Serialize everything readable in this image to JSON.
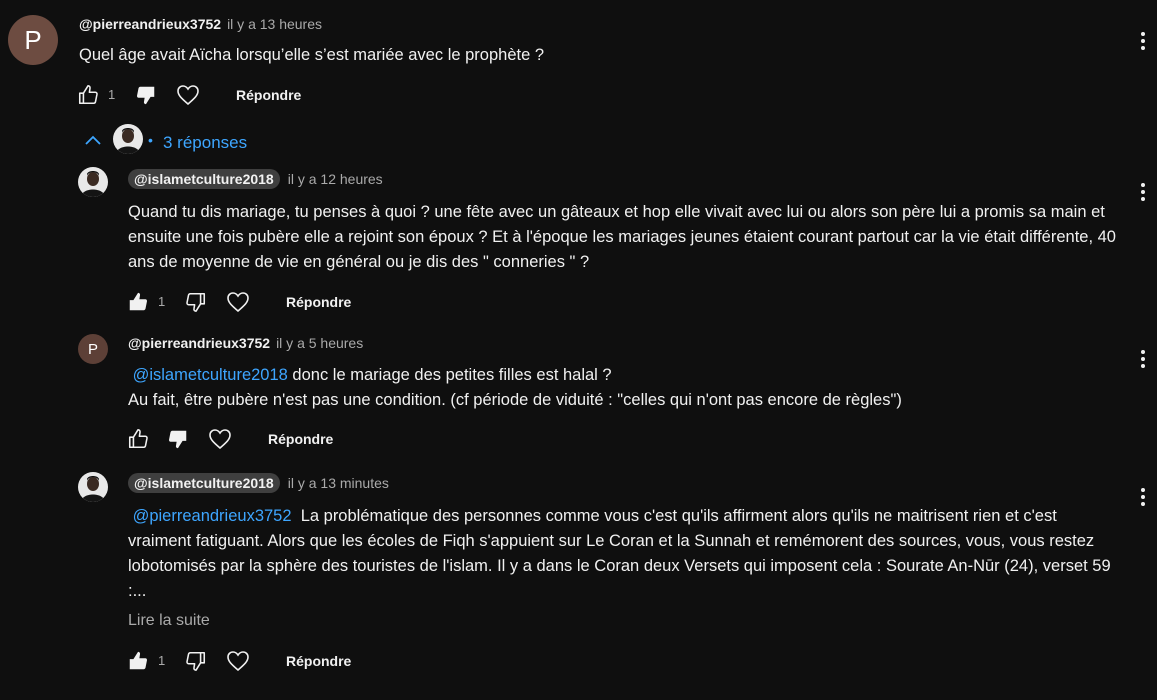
{
  "comment": {
    "avatar_letter": "P",
    "author": "@pierreandrieux3752",
    "time": "il y a 13 heures",
    "text": "Quel âge avait Aïcha lorsqu’elle s’est mariée avec le prophète ?",
    "likes": "1",
    "reply_label": "Répondre"
  },
  "replies_toggle": {
    "label": "3 réponses",
    "separator": "•"
  },
  "replies": [
    {
      "author": "@islametculture2018",
      "time": "il y a 12 heures",
      "text": "Quand tu dis mariage, tu penses à quoi ? une fête avec un gâteaux et hop elle vivait avec lui ou alors son père lui a promis sa main et ensuite une fois pubère elle a rejoint son époux ? Et à l'époque les mariages jeunes étaient courant partout car la vie était différente, 40 ans de moyenne de vie en général ou je dis des \" conneries \" ?",
      "likes": "1",
      "reply_label": "Répondre"
    },
    {
      "avatar_letter": "P",
      "author": "@pierreandrieux3752",
      "time": "il y a 5 heures",
      "mention": "@islametculture2018",
      "text_line1": " donc le mariage des petites filles est halal ?",
      "text_line2": "Au fait, être pubère n'est pas une condition. (cf période de viduité : \"celles qui n'ont pas encore de règles\")",
      "reply_label": "Répondre"
    },
    {
      "author": "@islametculture2018",
      "time": "il y a 13 minutes",
      "mention": "@pierreandrieux3752",
      "text": "  La problématique des personnes comme vous c'est qu'ils affirment alors qu'ils ne maitrisent rien et c'est vraiment fatiguant. Alors que les écoles de Fiqh s'appuient sur Le Coran et la Sunnah et remémorent des sources, vous, vous restez lobotomisés par la sphère des touristes de l'islam. Il y a dans le Coran deux Versets qui imposent cela : Sourate An-Nūr (24), verset 59 :...",
      "read_more": "Lire la suite",
      "likes": "1",
      "reply_label": "Répondre"
    }
  ],
  "icons": {
    "like": "thumbs-up-icon",
    "dislike": "thumbs-down-icon",
    "heart": "heart-icon",
    "more": "more-vertical-icon",
    "collapse": "chevron-up-icon"
  },
  "colors": {
    "background": "#0f0f0f",
    "avatar_p_main": "#6d4c41",
    "avatar_p_reply": "#5d4037",
    "link_blue": "#3ea6ff",
    "secondary_text": "#aaaaaa"
  }
}
